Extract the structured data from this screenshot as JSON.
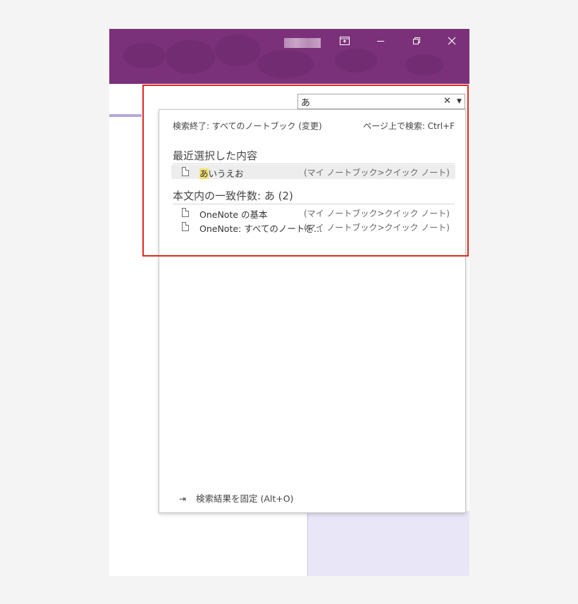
{
  "window": {
    "blurred_title": "",
    "controls": {
      "ribbon_display_icon": "ribbon-display-options-icon",
      "minimize_icon": "minimize-icon",
      "restore_icon": "restore-icon",
      "close_icon": "close-icon"
    },
    "titlebar_color": "#7b3179"
  },
  "search": {
    "query": "あ",
    "clear_icon": "clear-icon",
    "dropdown_icon": "dropdown-arrow-icon"
  },
  "results_panel": {
    "scope_text": "検索終了: すべてのノートブック (変更)",
    "page_search_text": "ページ上で検索: Ctrl+F",
    "recent_section_title": "最近選択した内容",
    "recent_items": [
      {
        "title_highlight": "あ",
        "title_rest": "いうえお",
        "location": "(マイ ノートブック>クイック ノート)",
        "selected": true
      }
    ],
    "match_section_title": "本文内の一致件数: あ (2)",
    "match_items": [
      {
        "title": "OneNote の基本",
        "location": "(マイ ノートブック>クイック ノート)"
      },
      {
        "title": "OneNote: すべてのノートを 1 か所で",
        "location": "(マイ ノートブック>クイック ノート)"
      }
    ],
    "pin_text": "検索結果を固定 (Alt+O)",
    "pin_icon": "pin-icon"
  },
  "colors": {
    "highlight_frame": "#e2271d",
    "match_highlight": "#f4e36e",
    "page_tab_accent": "#b4a9dc"
  }
}
